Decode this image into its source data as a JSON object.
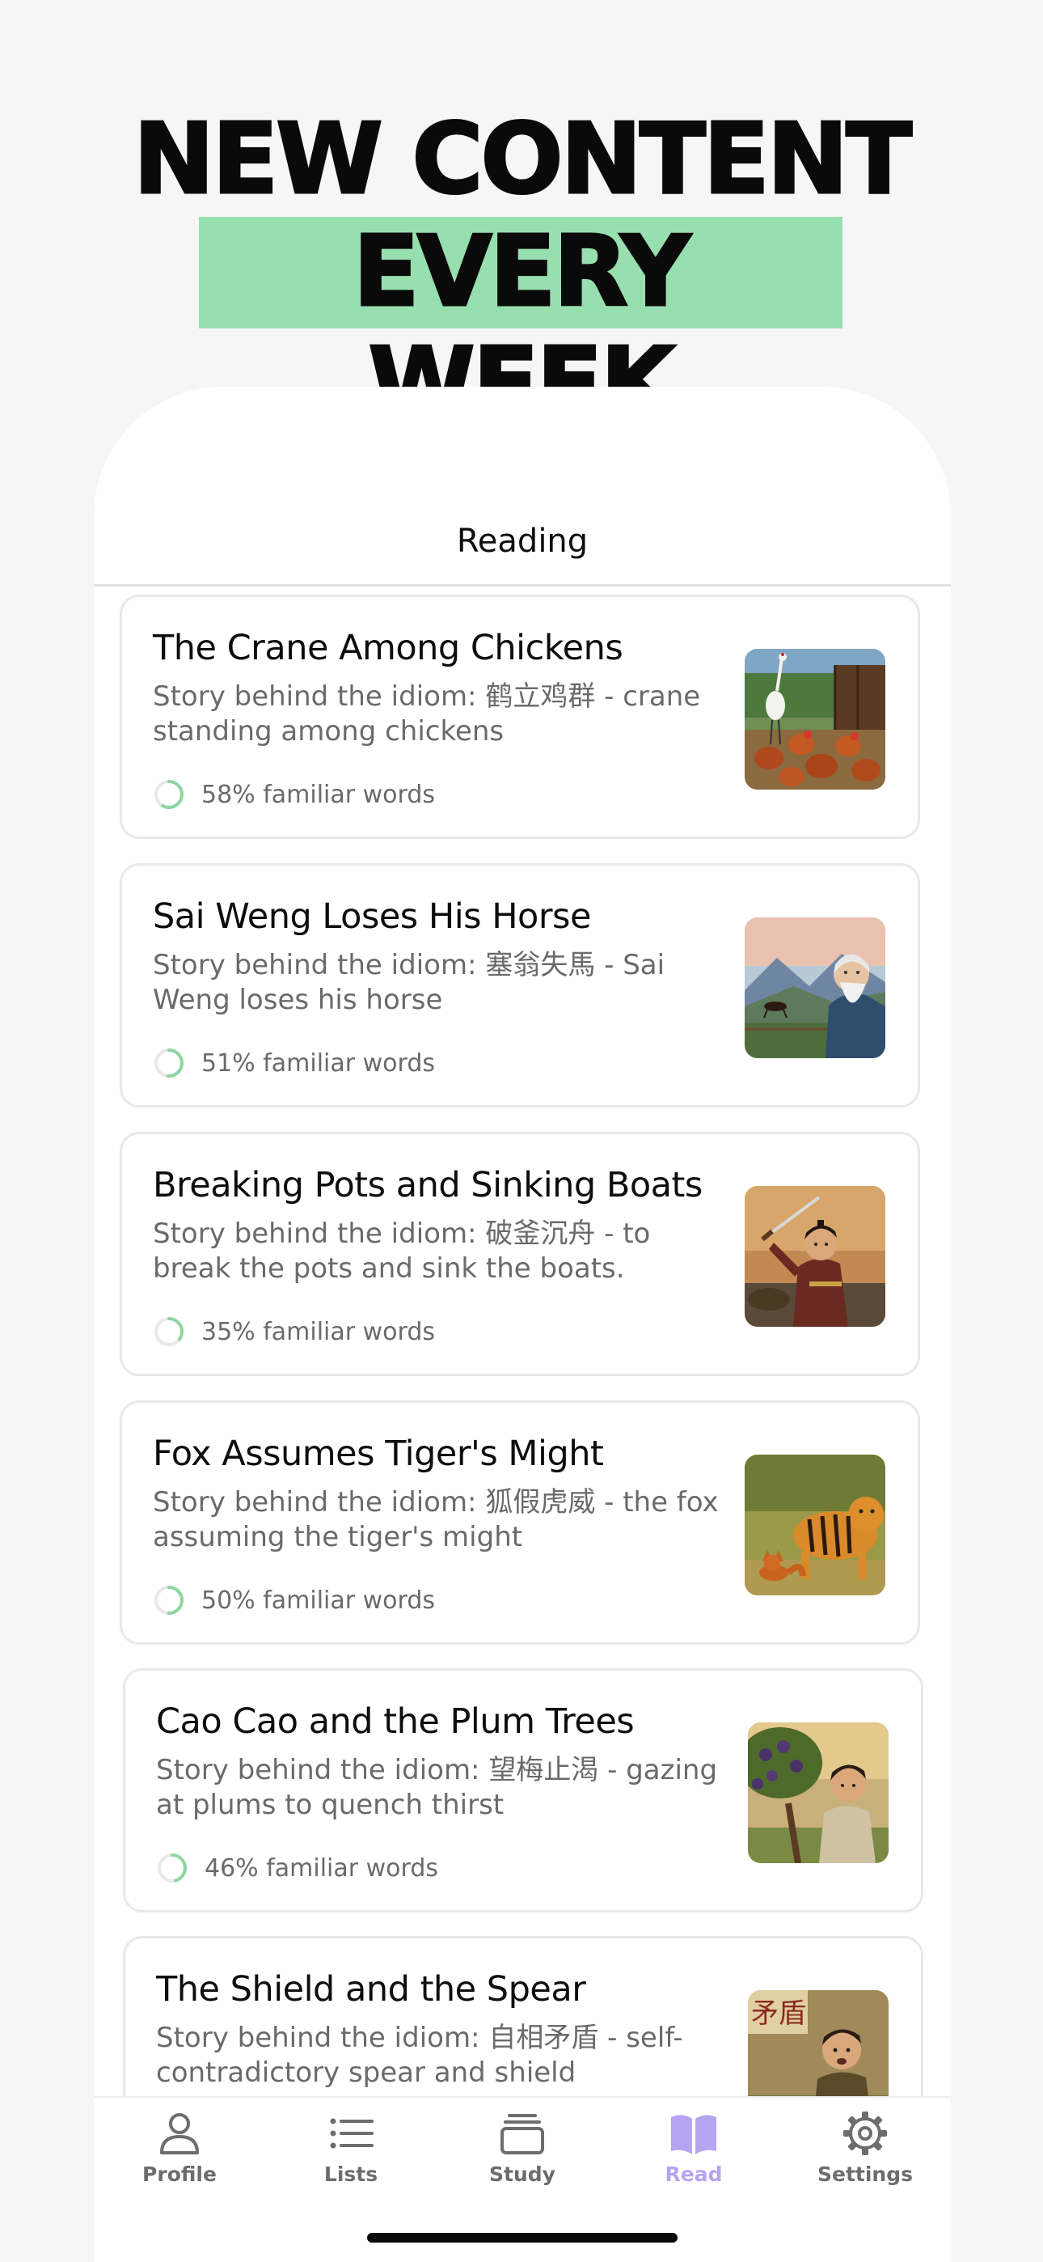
{
  "hero": {
    "line1": "NEW CONTENT",
    "line2": "EVERY WEEK"
  },
  "header": {
    "title": "Reading"
  },
  "stories": [
    {
      "title": "The Crane Among Chickens",
      "description": "Story behind the idiom: 鹤立鸡群 - crane standing among chickens",
      "progress_label": "58% familiar words",
      "familiar_fraction": 0.58,
      "image": "crane-among-chickens-illustration"
    },
    {
      "title": "Sai Weng Loses His Horse",
      "description": "Story behind the idiom: 塞翁失馬 - Sai Weng loses his horse",
      "progress_label": "51% familiar words",
      "familiar_fraction": 0.51,
      "image": "old-man-and-horse-illustration"
    },
    {
      "title": "Breaking Pots and Sinking Boats",
      "description": "Story behind the idiom: 破釜沉舟 - to break the pots and sink the boats.",
      "progress_label": "35% familiar words",
      "familiar_fraction": 0.35,
      "image": "warrior-with-sword-illustration"
    },
    {
      "title": "Fox Assumes Tiger's Might",
      "description": "Story behind the idiom: 狐假虎威 - the fox assuming the tiger's might",
      "progress_label": "50% familiar words",
      "familiar_fraction": 0.5,
      "image": "fox-and-tiger-illustration"
    },
    {
      "title": "Cao Cao and the Plum Trees",
      "description": "Story behind the idiom: 望梅止渴 - gazing at plums to quench thirst",
      "progress_label": "46% familiar words",
      "familiar_fraction": 0.46,
      "image": "soldier-and-plum-tree-illustration"
    },
    {
      "title": "The Shield and the Spear",
      "description": "Story behind the idiom: 自相矛盾 - self-contradictory spear and shield",
      "progress_label": "",
      "familiar_fraction": null,
      "image": "merchant-with-sign-illustration",
      "sign_text": "矛盾"
    }
  ],
  "tabs": [
    {
      "label": "Profile",
      "icon": "person-icon",
      "active": false
    },
    {
      "label": "Lists",
      "icon": "list-icon",
      "active": false
    },
    {
      "label": "Study",
      "icon": "card-stack-icon",
      "active": false
    },
    {
      "label": "Read",
      "icon": "open-book-icon",
      "active": true
    },
    {
      "label": "Settings",
      "icon": "gear-icon",
      "active": false
    }
  ],
  "colors": {
    "accent_green": "#98dfb0",
    "progress_green": "#8fd6a0",
    "active_tab": "#b7a4f0",
    "inactive_tab": "#6d6d6d"
  }
}
